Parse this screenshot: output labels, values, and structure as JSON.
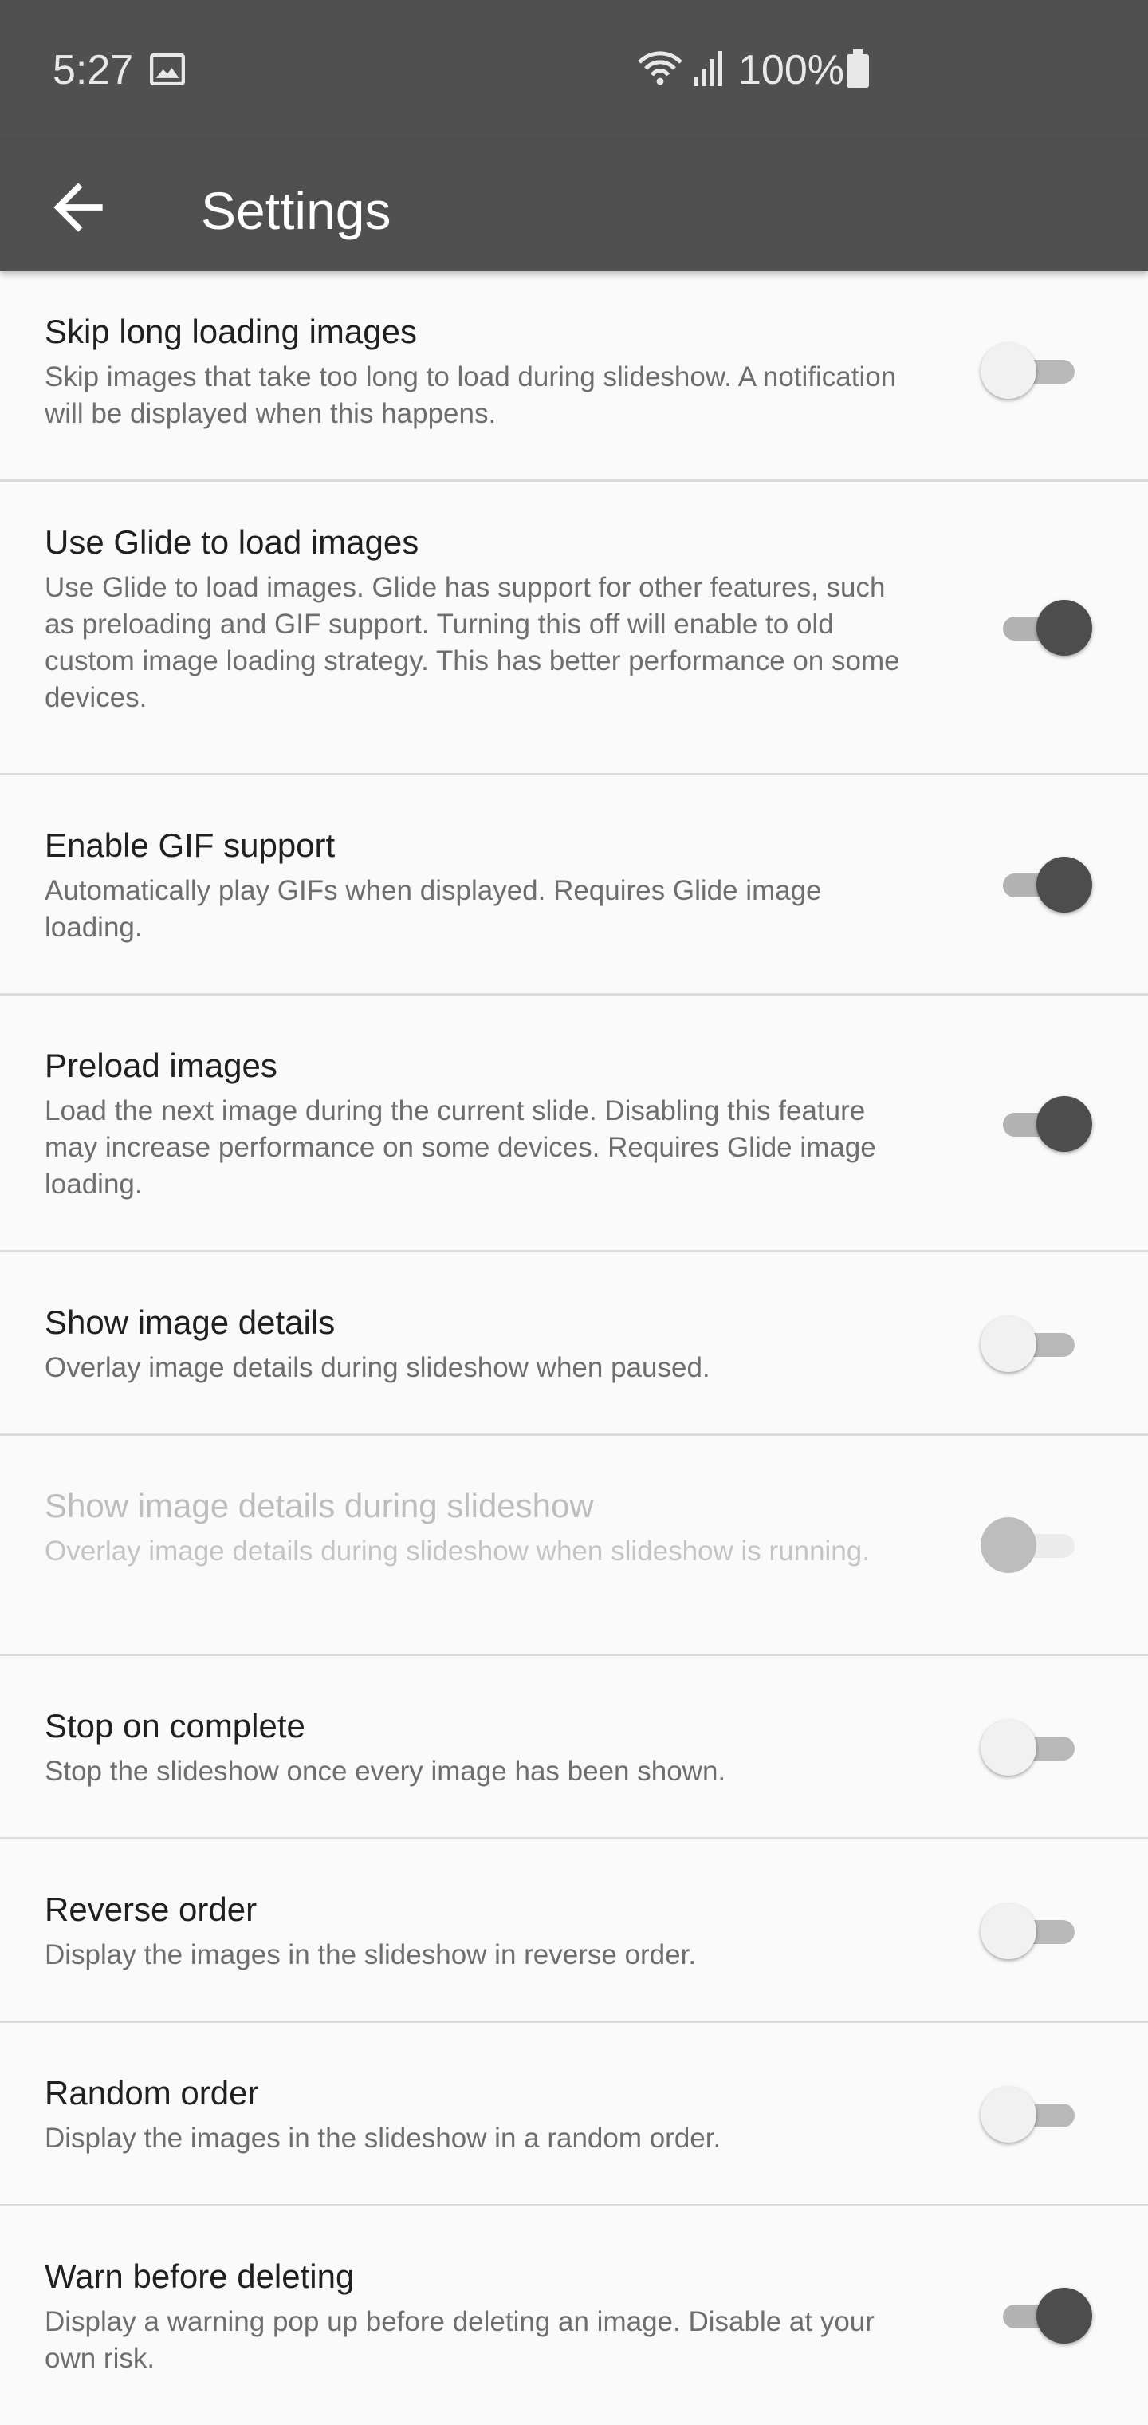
{
  "status_bar": {
    "time": "5:27",
    "battery": "100%",
    "icons": [
      "image-icon",
      "wifi-icon",
      "signal-icon",
      "battery-icon"
    ]
  },
  "app_bar": {
    "title": "Settings",
    "back_icon": "arrow-left-icon"
  },
  "settings": [
    {
      "title": "Skip long loading images",
      "summary": "Skip images that take too long to load during slideshow. A notification will be displayed when this happens.",
      "enabled": false,
      "disabled": false
    },
    {
      "title": "Use Glide to load images",
      "summary": "Use Glide to load images. Glide has support for other features, such as preloading and GIF support. Turning this off will enable to old custom image loading strategy. This has better performance on some devices.",
      "enabled": true,
      "disabled": false
    },
    {
      "title": "Enable GIF support",
      "summary": "Automatically play GIFs when displayed. Requires Glide image loading.",
      "enabled": true,
      "disabled": false
    },
    {
      "title": "Preload images",
      "summary": "Load the next image during the current slide. Disabling this feature may increase performance on some devices. Requires Glide image loading.",
      "enabled": true,
      "disabled": false
    },
    {
      "title": "Show image details",
      "summary": "Overlay image details during slideshow when paused.",
      "enabled": false,
      "disabled": false
    },
    {
      "title": "Show image details during slideshow",
      "summary": "Overlay image details during slideshow when slideshow is running.",
      "enabled": false,
      "disabled": true
    },
    {
      "title": "Stop on complete",
      "summary": "Stop the slideshow once every image has been shown.",
      "enabled": false,
      "disabled": false
    },
    {
      "title": "Reverse order",
      "summary": "Display the images in the slideshow in reverse order.",
      "enabled": false,
      "disabled": false
    },
    {
      "title": "Random order",
      "summary": "Display the images in the slideshow in a random order.",
      "enabled": false,
      "disabled": false
    },
    {
      "title": "Warn before deleting",
      "summary": "Display a warning pop up before deleting an image. Disable at your own risk.",
      "enabled": true,
      "disabled": false
    }
  ],
  "colors": {
    "app_bar": "#505050",
    "background": "#fafafa",
    "switch_on_thumb": "#4d4d4d",
    "switch_off_thumb": "#f1f1f1"
  }
}
